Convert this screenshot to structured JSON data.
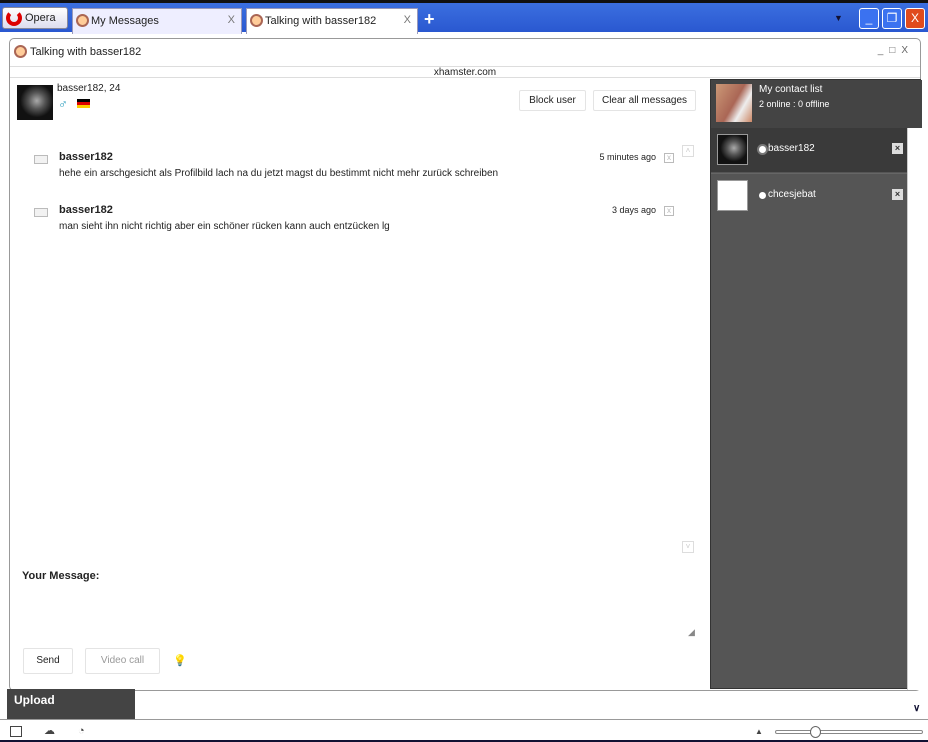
{
  "browser": {
    "opera_label": "Opera",
    "tabs": [
      {
        "label": "My Messages",
        "active": false
      },
      {
        "label": "Talking with basser182",
        "active": true
      }
    ],
    "close_glyph": "X"
  },
  "window": {
    "title": "Talking with basser182",
    "domain": "xhamster.com"
  },
  "user": {
    "name_age": "basser182, 24",
    "gender_icon": "male-symbol-icon",
    "flag_icon": "germany-flag-icon"
  },
  "actions": {
    "block": "Block user",
    "clear": "Clear all messages"
  },
  "messages": [
    {
      "sender": "basser182",
      "time": "5 minutes ago",
      "text": "hehe ein arschgesicht als Profilbild lach na du jetzt magst du bestimmt nicht mehr zurück schreiben"
    },
    {
      "sender": "basser182",
      "time": "3 days ago",
      "text": "man sieht ihn nicht richtig aber ein schöner rücken kann auch entzücken lg"
    }
  ],
  "compose": {
    "label": "Your Message:",
    "value": "",
    "send": "Send",
    "video_call": "Video call"
  },
  "contacts": {
    "title": "My contact list",
    "summary": "2 online : 0 offline",
    "items": [
      {
        "name": "basser182",
        "selected": true
      },
      {
        "name": "chcesjebat",
        "selected": false
      }
    ]
  },
  "upload_label": "Upload",
  "zoom_slider_value": 0.25,
  "colors": {
    "tabbar": "#2a58d0",
    "sidebar": "#555555",
    "close": "#e04b1d"
  }
}
